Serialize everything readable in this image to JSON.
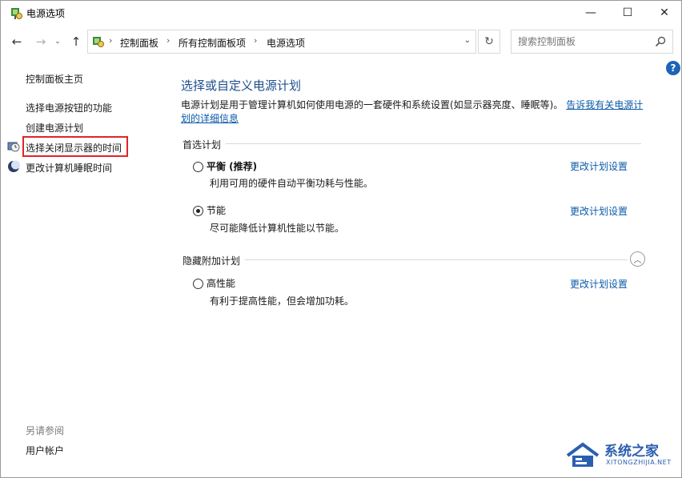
{
  "window": {
    "title": "电源选项",
    "minimize": "—",
    "maximize": "☐",
    "close": "✕"
  },
  "nav": {
    "back": "←",
    "forward": "→",
    "recent": "⌄",
    "up": "↑",
    "breadcrumbs": [
      "控制面板",
      "所有控制面板项",
      "电源选项"
    ],
    "separator": "›",
    "dropdown": "⌄",
    "refresh": "↻",
    "search_placeholder": "搜索控制面板"
  },
  "help": {
    "label": "?"
  },
  "sidebar": {
    "home": "控制面板主页",
    "links": [
      "选择电源按钮的功能",
      "创建电源计划",
      "选择关闭显示器的时间",
      "更改计算机睡眠时间"
    ],
    "see_also_title": "另请参阅",
    "see_also": [
      "用户帐户"
    ]
  },
  "main": {
    "title": "选择或自定义电源计划",
    "description": "电源计划是用于管理计算机如何使用电源的一套硬件和系统设置(如显示器亮度、睡眠等)。",
    "description_link": "告诉我有关电源计划的详细信息",
    "preferred_label": "首选计划",
    "hidden_label": "隐藏附加计划",
    "collapse_icon": "︿",
    "plans": [
      {
        "name": "平衡 (推荐)",
        "description": "利用可用的硬件自动平衡功耗与性能。",
        "link": "更改计划设置",
        "selected": false
      },
      {
        "name": "节能",
        "description": "尽可能降低计算机性能以节能。",
        "link": "更改计划设置",
        "selected": true
      },
      {
        "name": "高性能",
        "description": "有利于提高性能，但会增加功耗。",
        "link": "更改计划设置",
        "selected": false
      }
    ]
  },
  "watermark": {
    "name": "系统之家",
    "url": "XITONGZHIJIA.NET"
  },
  "colors": {
    "accent_link": "#0b5aa8",
    "title_blue": "#1e4e8c",
    "highlight_red": "#e0242a"
  }
}
